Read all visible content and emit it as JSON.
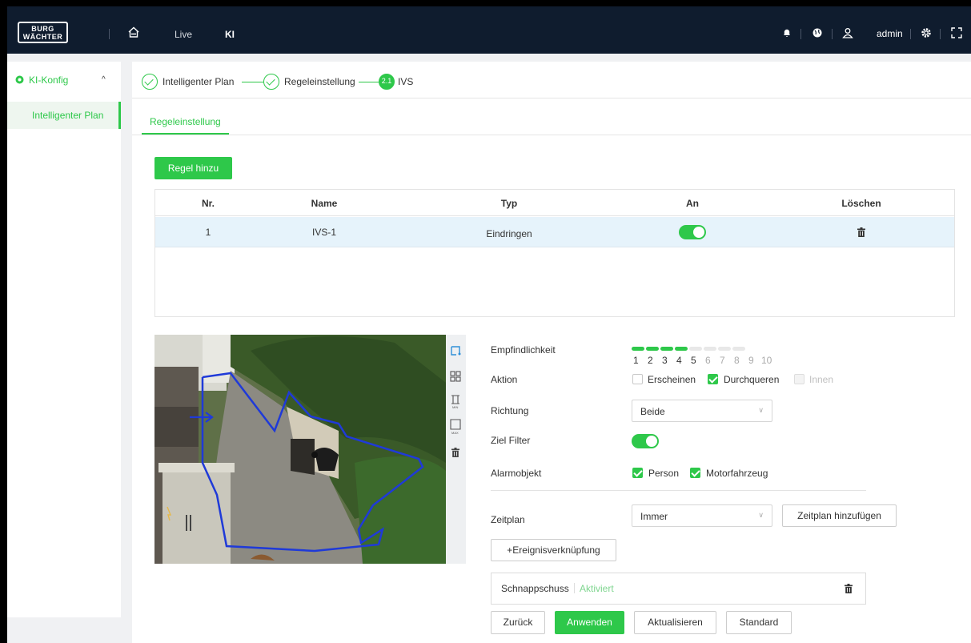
{
  "header": {
    "logo_line1": "BURG",
    "logo_line2": "WÄCHTER",
    "nav_live": "Live",
    "nav_ki": "KI",
    "user": "admin"
  },
  "sidebar": {
    "group_label": "KI-Konfig",
    "items": [
      {
        "label": "Intelligenter Plan"
      }
    ]
  },
  "steps": [
    {
      "label": "Intelligenter Plan",
      "state": "done"
    },
    {
      "label": "Regeleinstellung",
      "state": "done"
    },
    {
      "label": "IVS",
      "state": "current",
      "number": "2.1"
    }
  ],
  "tab": "Regeleinstellung",
  "add_rule_button": "Regel hinzu",
  "table": {
    "headers": [
      "Nr.",
      "Name",
      "Typ",
      "An",
      "Löschen"
    ],
    "rows": [
      {
        "nr": "1",
        "name": "IVS-1",
        "typ": "Eindringen",
        "enabled": true
      }
    ]
  },
  "form": {
    "sensitivity_label": "Empfindlichkeit",
    "sensitivity_value": 5,
    "sensitivity_scale": [
      "1",
      "2",
      "3",
      "4",
      "5",
      "6",
      "7",
      "8",
      "9",
      "10"
    ],
    "action_label": "Aktion",
    "actions": [
      {
        "label": "Erscheinen",
        "checked": false,
        "disabled": false
      },
      {
        "label": "Durchqueren",
        "checked": true,
        "disabled": false
      },
      {
        "label": "Innen",
        "checked": false,
        "disabled": true
      }
    ],
    "direction_label": "Richtung",
    "direction_value": "Beide",
    "target_filter_label": "Ziel Filter",
    "target_filter_on": true,
    "alarm_object_label": "Alarmobjekt",
    "alarm_objects": [
      {
        "label": "Person",
        "checked": true
      },
      {
        "label": "Motorfahrzeug",
        "checked": true
      }
    ],
    "schedule_label": "Zeitplan",
    "schedule_value": "Immer",
    "add_schedule_button": "Zeitplan hinzufügen",
    "event_link_button": "+Ereignisverknüpfung",
    "snapshot_label": "Schnappschuss",
    "snapshot_status": "Aktiviert"
  },
  "footer_buttons": {
    "back": "Zurück",
    "apply": "Anwenden",
    "refresh": "Aktualisieren",
    "default": "Standard"
  },
  "colors": {
    "accent": "#2ec84a",
    "topbar": "#0f1c2e",
    "row_highlight": "#e6f3fb",
    "zone_line": "#1f3ad8"
  }
}
